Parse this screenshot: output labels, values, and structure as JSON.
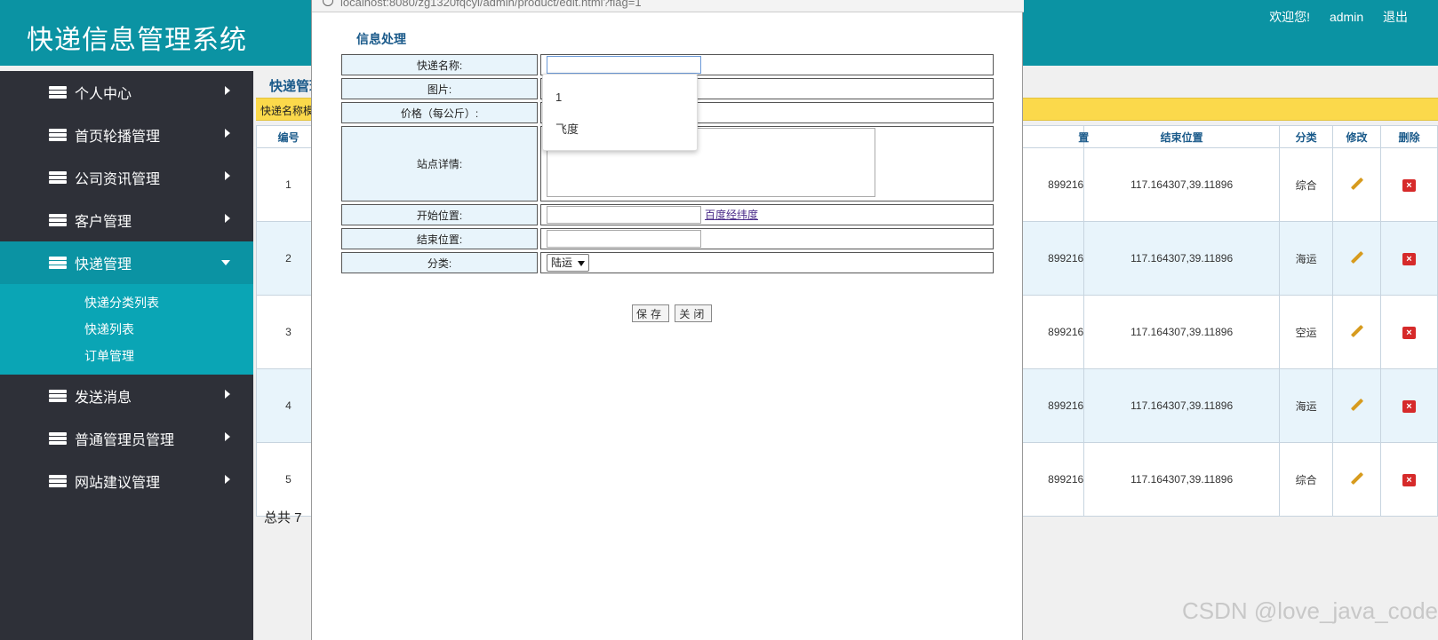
{
  "header": {
    "app_title": "快递信息管理系统",
    "welcome": "欢迎您!",
    "username": "admin",
    "logout": "退出"
  },
  "sidebar": {
    "items": [
      {
        "label": "个人中心"
      },
      {
        "label": "首页轮播管理"
      },
      {
        "label": "公司资讯管理"
      },
      {
        "label": "客户管理"
      },
      {
        "label": "快递管理",
        "active": true
      },
      {
        "label": "发送消息"
      },
      {
        "label": "普通管理员管理"
      },
      {
        "label": "网站建议管理"
      }
    ],
    "submenu": [
      "快递分类列表",
      "快递列表",
      "订单管理"
    ]
  },
  "main": {
    "page_heading": "快递管理",
    "search_label": "快递名称模",
    "table": {
      "columns": [
        "编号",
        "开始位置",
        "结束位置",
        "分类",
        "修改",
        "删除"
      ],
      "rows": [
        {
          "id": "1",
          "start": "899216",
          "end": "117.164307,39.11896",
          "category": "综合"
        },
        {
          "id": "2",
          "start": "899216",
          "end": "117.164307,39.11896",
          "category": "海运"
        },
        {
          "id": "3",
          "start": "899216",
          "end": "117.164307,39.11896",
          "category": "空运"
        },
        {
          "id": "4",
          "start": "899216",
          "end": "117.164307,39.11896",
          "category": "海运"
        },
        {
          "id": "5",
          "start": "899216",
          "end": "117.164307,39.11896",
          "category": "综合"
        }
      ]
    },
    "total_text": "总共 7"
  },
  "modal": {
    "url": "localhost:8080/zg1320fqcyi/admin/product/edit.html?flag=1",
    "form_title": "信息处理",
    "fields": {
      "name_label": "快递名称:",
      "image_label": "图片:",
      "price_label": "价格（每公斤）:",
      "station_label": "站点详情:",
      "start_label": "开始位置:",
      "end_label": "结束位置:",
      "category_label": "分类:"
    },
    "map_link": "百度经纬度",
    "category_value": "陆运",
    "save_button": "保存",
    "close_button": "关闭",
    "autocomplete": [
      "1",
      "飞度"
    ]
  },
  "watermark": "CSDN @love_java_code"
}
